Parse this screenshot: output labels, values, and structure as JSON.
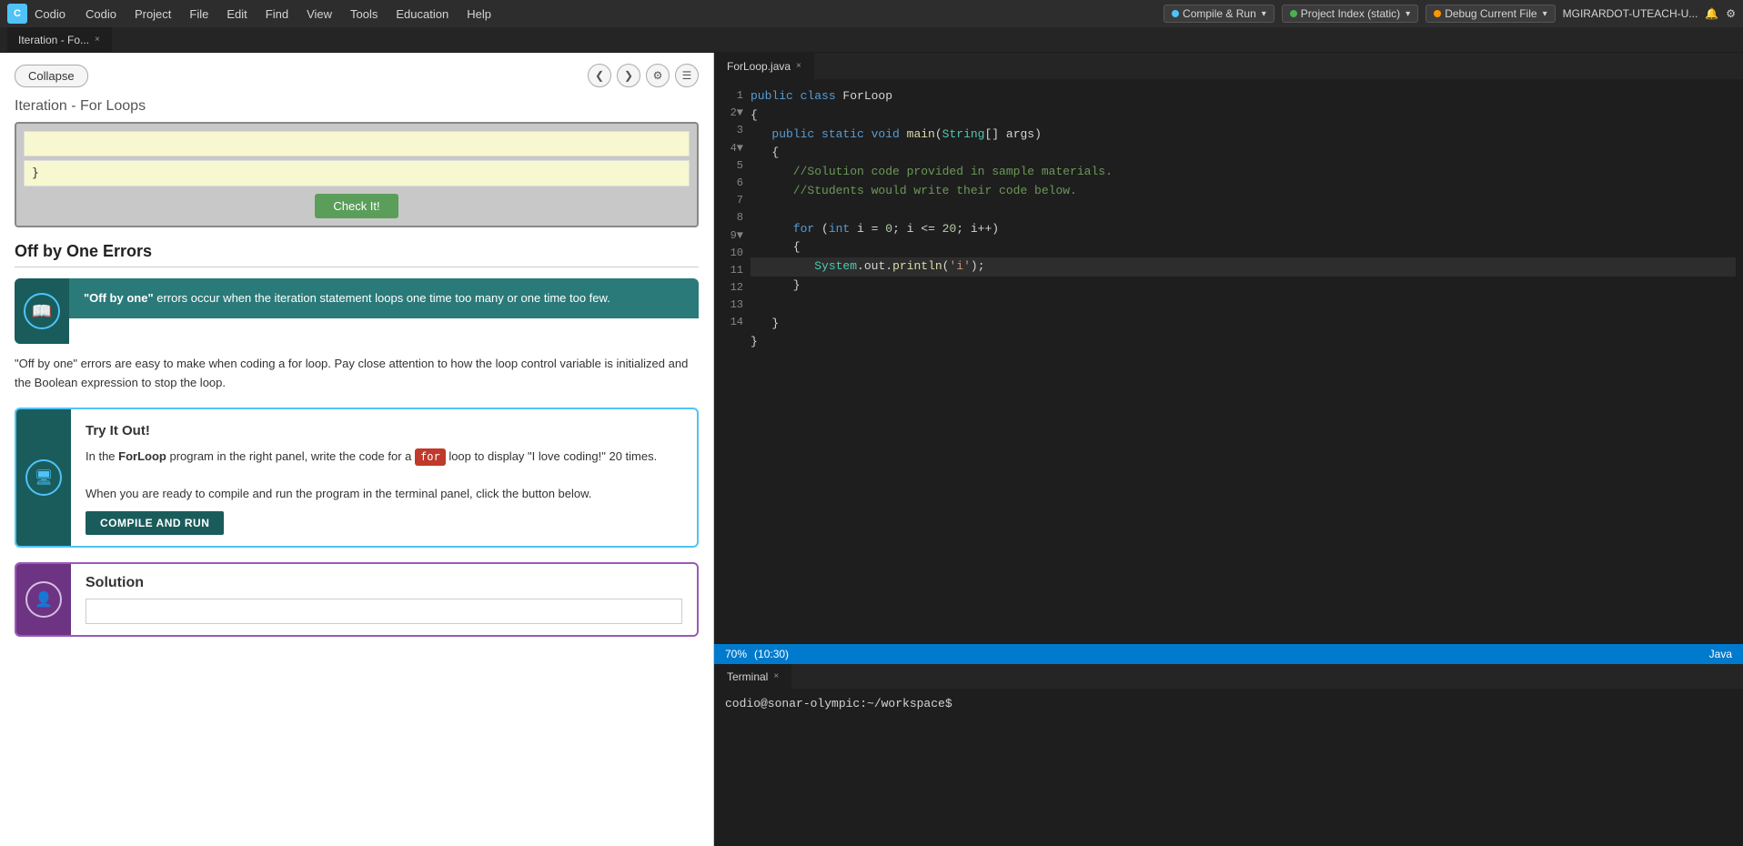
{
  "app": {
    "logo": "C",
    "name": "Codio",
    "window_title": "Iteration - Fo..."
  },
  "menu": {
    "items": [
      "Codio",
      "Project",
      "File",
      "Edit",
      "Find",
      "View",
      "Tools",
      "Education",
      "Help"
    ]
  },
  "toolbar": {
    "compile_run_label": "Compile & Run",
    "project_index_label": "Project Index (static)",
    "debug_label": "Debug Current File"
  },
  "left_tab": {
    "label": "Iteration - Fo...",
    "close": "×"
  },
  "collapse_btn": "Collapse",
  "page_title": "Iteration - For Loops",
  "code_input": {
    "line1": "",
    "line2": "}",
    "check_btn": "Check It!"
  },
  "off_by_one": {
    "title": "Off by One Errors",
    "card_bold": "\"Off by one\"",
    "card_text": " errors occur when the iteration statement loops one time too many or one time too few.",
    "description": "\"Off by one\" errors are easy to make when coding a for loop. Pay close attention to how the loop control variable is initialized and the Boolean expression to stop the loop."
  },
  "try_it_out": {
    "title": "Try It Out!",
    "body_part1": "In the ",
    "body_forloop": "ForLoop",
    "body_part2": " program in the right panel, write the code for a ",
    "for_badge": "for",
    "body_part3": " loop to display \"I love coding!\" 20 times.",
    "body_part4": "When you are ready to compile and run the program in the terminal panel, click the button below.",
    "compile_btn": "COMPILE AND RUN"
  },
  "solution": {
    "title": "Solution",
    "input_placeholder": ""
  },
  "editor": {
    "file_name": "ForLoop.java",
    "close": "×",
    "lines": [
      {
        "num": "1",
        "content": "public class ForLoop",
        "tokens": [
          {
            "text": "public ",
            "cls": "kw"
          },
          {
            "text": "class ",
            "cls": "kw"
          },
          {
            "text": "ForLoop",
            "cls": ""
          }
        ]
      },
      {
        "num": "2",
        "content": "{",
        "fold": true
      },
      {
        "num": "3",
        "content": "   public static void main(String[] args)",
        "tokens": [
          {
            "text": "   ",
            "cls": ""
          },
          {
            "text": "public ",
            "cls": "kw"
          },
          {
            "text": "static ",
            "cls": "kw"
          },
          {
            "text": "void ",
            "cls": "kw"
          },
          {
            "text": "main",
            "cls": "method"
          },
          {
            "text": "(",
            "cls": ""
          },
          {
            "text": "String",
            "cls": "type"
          },
          {
            "text": "[] args)",
            "cls": ""
          }
        ]
      },
      {
        "num": "4",
        "content": "   {",
        "fold": true
      },
      {
        "num": "5",
        "content": "      //Solution code provided in sample materials.",
        "cls": "comment"
      },
      {
        "num": "6",
        "content": "      //Students would write their code below.",
        "cls": "comment"
      },
      {
        "num": "7",
        "content": ""
      },
      {
        "num": "8",
        "content": "      for (int i = 0; i <= 20; i++)"
      },
      {
        "num": "9",
        "content": "      {",
        "fold": true
      },
      {
        "num": "10",
        "content": "         System.out.println('i');",
        "highlighted": true
      },
      {
        "num": "11",
        "content": "      }"
      },
      {
        "num": "12",
        "content": ""
      },
      {
        "num": "13",
        "content": "   }"
      },
      {
        "num": "14",
        "content": "}"
      }
    ]
  },
  "status_bar": {
    "zoom": "70%",
    "position": "(10:30)",
    "language": "Java"
  },
  "terminal": {
    "tab_label": "Terminal",
    "close": "×",
    "prompt": "codio@sonar-olympic:~/workspace$"
  },
  "icons": {
    "left_arrow": "❮",
    "right_arrow": "❯",
    "gear": "⚙",
    "list": "☰",
    "dropdown_arrow": "▾",
    "fold": "▼"
  }
}
